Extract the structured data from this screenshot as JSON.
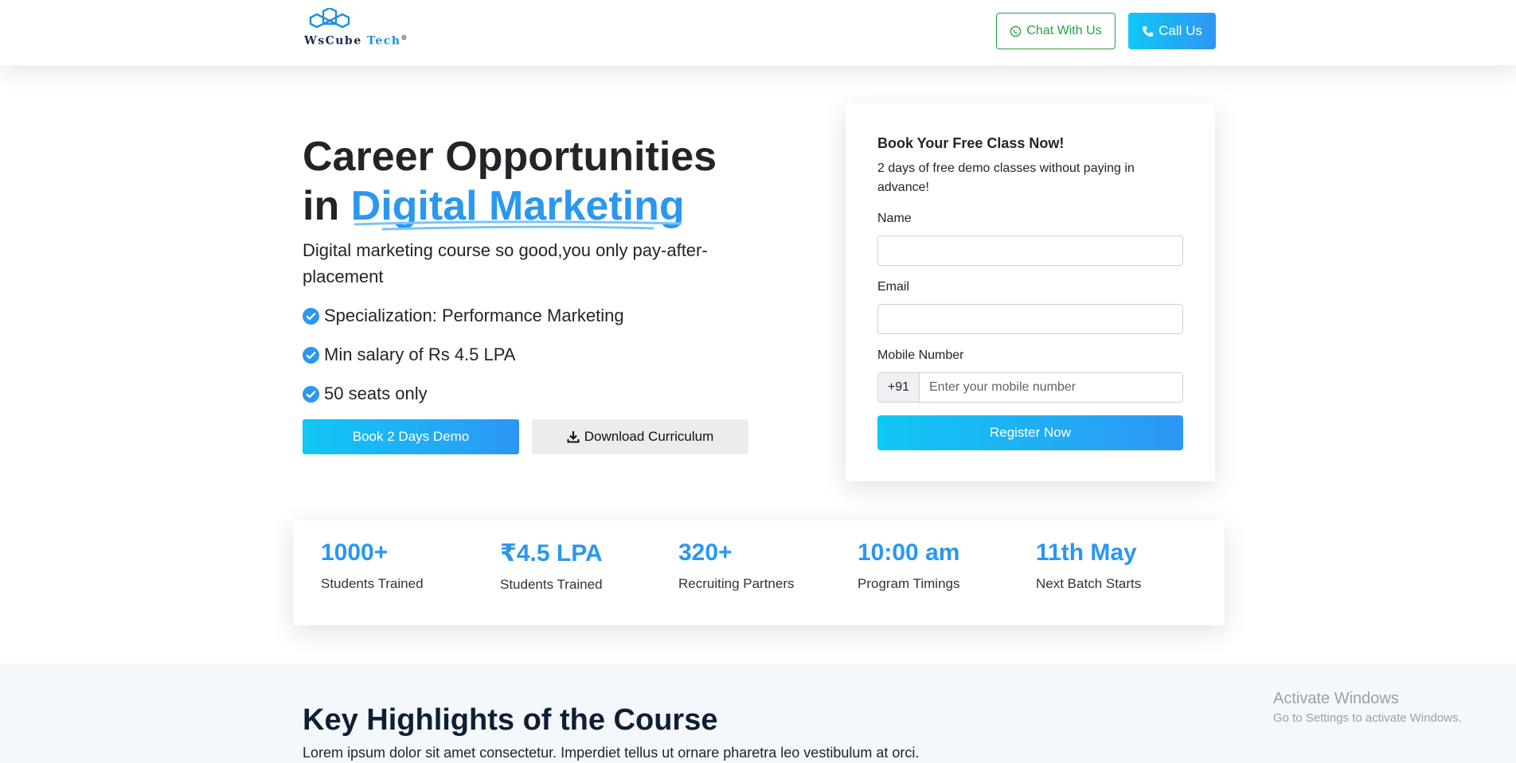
{
  "header": {
    "logo": {
      "name": "WsCube",
      "name_accent": "Tech",
      "mark": "®"
    },
    "chat_label": "Chat With Us",
    "call_label": "Call Us"
  },
  "hero": {
    "title_line1": "Career Opportunities",
    "title_prefix": "in ",
    "title_accent": "Digital Marketing",
    "subtitle": "Digital marketing course so good,you only pay-after-placement",
    "checks": [
      "Specialization: Performance Marketing",
      "Min salary of Rs 4.5 LPA",
      "50 seats only"
    ],
    "demo_button": "Book 2 Days Demo",
    "download_button": "Download Curriculum"
  },
  "form": {
    "title": "Book Your Free Class Now!",
    "description": "2 days of free demo classes without paying in advance!",
    "name_label": "Name",
    "name_value": "",
    "email_label": "Email",
    "email_value": "",
    "mobile_label": "Mobile Number",
    "country_code": "+91",
    "mobile_placeholder": "Enter your mobile number",
    "submit_label": "Register Now"
  },
  "stats": [
    {
      "value": "1000+",
      "label": "Students Trained"
    },
    {
      "value": "₹4.5 LPA",
      "label": "Students Trained"
    },
    {
      "value": "320+",
      "label": "Recruiting Partners"
    },
    {
      "value": "10:00 am",
      "label": "Program Timings"
    },
    {
      "value": "11th May",
      "label": "Next Batch Starts"
    }
  ],
  "highlights": {
    "title": "Key Highlights of the Course",
    "text": "Lorem ipsum dolor sit amet consectetur. Imperdiet tellus ut ornare pharetra leo vestibulum at orci."
  },
  "watermark": {
    "title": "Activate Windows",
    "subtitle": "Go to Settings to activate Windows."
  },
  "colors": {
    "accent": "#2a97f0",
    "gradient_start": "#10c8f5",
    "gradient_end": "#2e96f5",
    "whatsapp_green": "#25a244"
  }
}
